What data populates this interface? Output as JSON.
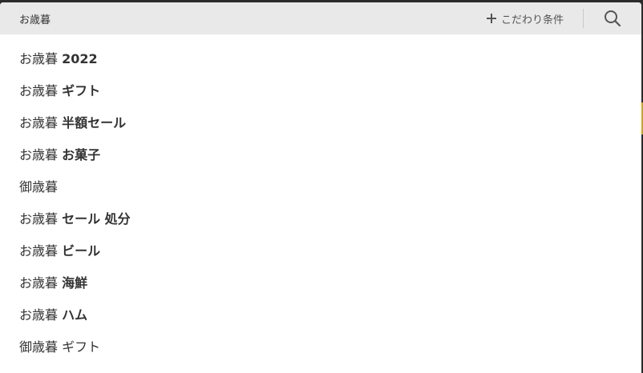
{
  "search": {
    "value": "お歳暮",
    "conditions_label": "こだわり条件"
  },
  "icons": {
    "plus": "plus-icon",
    "search": "search-icon"
  },
  "suggestions": [
    {
      "base": "お歳暮",
      "highlight": "2022"
    },
    {
      "base": "お歳暮",
      "highlight": "ギフト"
    },
    {
      "base": "お歳暮",
      "highlight": "半額セール"
    },
    {
      "base": "お歳暮",
      "highlight": "お菓子"
    },
    {
      "base": "御歳暮",
      "highlight": ""
    },
    {
      "base": "お歳暮",
      "highlight": "セール 処分"
    },
    {
      "base": "お歳暮",
      "highlight": "ビール"
    },
    {
      "base": "お歳暮",
      "highlight": "海鮮"
    },
    {
      "base": "お歳暮",
      "highlight": "ハム"
    },
    {
      "base": "御歳暮 ギフト",
      "highlight": ""
    }
  ],
  "colors": {
    "bar_background": "#e9e9e9",
    "text": "#333333",
    "backdrop_accent": "#c9a227"
  }
}
